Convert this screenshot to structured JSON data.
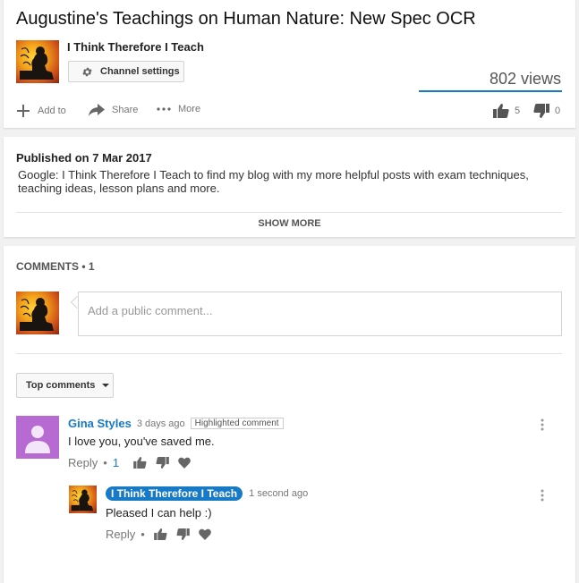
{
  "video": {
    "title": "Augustine's Teachings on Human Nature: New Spec OCR",
    "channel_name": "I Think Therefore I Teach",
    "channel_settings_label": "Channel settings",
    "views": "802 views"
  },
  "actions": {
    "add_to": "Add to",
    "share": "Share",
    "more": "More",
    "likes": "5",
    "dislikes": "0"
  },
  "description": {
    "published": "Published on 7 Mar 2017",
    "text": "Google: I Think Therefore I Teach to find my blog with my more helpful posts with exam techniques, teaching ideas, lesson plans and more.",
    "show_more": "SHOW MORE"
  },
  "comments": {
    "header": "COMMENTS • 1",
    "placeholder": "Add a public comment...",
    "sort_label": "Top comments",
    "items": [
      {
        "author": "Gina Styles",
        "time": "3 days ago",
        "badge": "Highlighted comment",
        "text": "I love you, you've saved me.",
        "reply_label": "Reply",
        "separator": "•",
        "like_count": "1"
      }
    ],
    "replies": [
      {
        "author": "I Think Therefore I Teach",
        "time": "1 second ago",
        "text": "Pleased I can help :)",
        "reply_label": "Reply",
        "separator": "•"
      }
    ]
  },
  "colors": {
    "accent": "#167ac6",
    "avatar_purple": "#b86ad3"
  }
}
